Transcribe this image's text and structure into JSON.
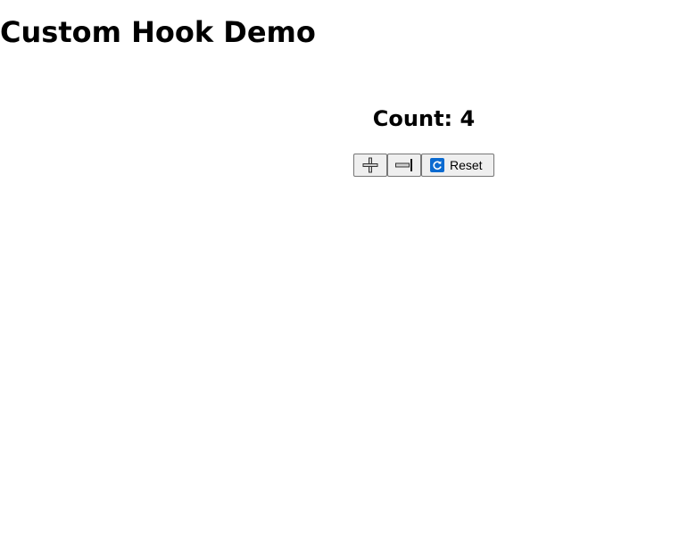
{
  "header": {
    "title": "Custom Hook Demo"
  },
  "counter": {
    "label": "Count: ",
    "value": "4"
  },
  "buttons": {
    "increment_icon": "plus-icon",
    "decrement_icon": "minus-icon",
    "reset_icon": "refresh-icon",
    "reset_label": "Reset"
  },
  "colors": {
    "reset_icon_bg": "#0a6ad0",
    "button_bg": "#efefef",
    "button_border": "#767676"
  }
}
